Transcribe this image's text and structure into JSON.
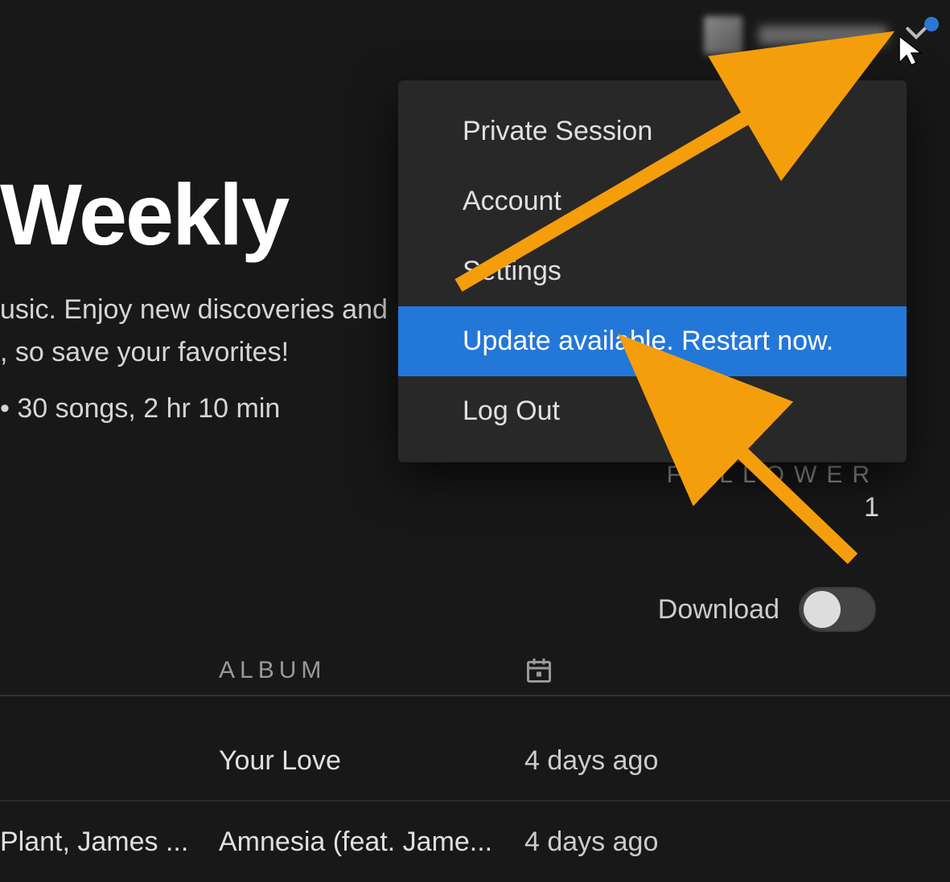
{
  "user": {
    "username_obscured": true
  },
  "menu": {
    "items": [
      {
        "label": "Private Session",
        "highlight": false
      },
      {
        "label": "Account",
        "highlight": false
      },
      {
        "label": "Settings",
        "highlight": false
      },
      {
        "label": "Update available. Restart now.",
        "highlight": true
      },
      {
        "label": "Log Out",
        "highlight": false
      }
    ]
  },
  "hero": {
    "title": "Weekly",
    "desc_line1": "usic. Enjoy new discoveries and",
    "desc_line2": ", so save your favorites!",
    "meta": " • 30 songs, 2 hr 10 min"
  },
  "follower": {
    "label": "FOLLOWER",
    "count": "1"
  },
  "download": {
    "label": "Download",
    "enabled": false
  },
  "table": {
    "columns": {
      "album": "ALBUM"
    },
    "rows": [
      {
        "artist": "",
        "album": "Your Love",
        "date": "4 days ago"
      },
      {
        "artist": "Plant, James ...",
        "album": "Amnesia (feat. Jame...",
        "date": "4 days ago"
      }
    ]
  },
  "annotations": {
    "arrow_color": "#f59e0b"
  }
}
